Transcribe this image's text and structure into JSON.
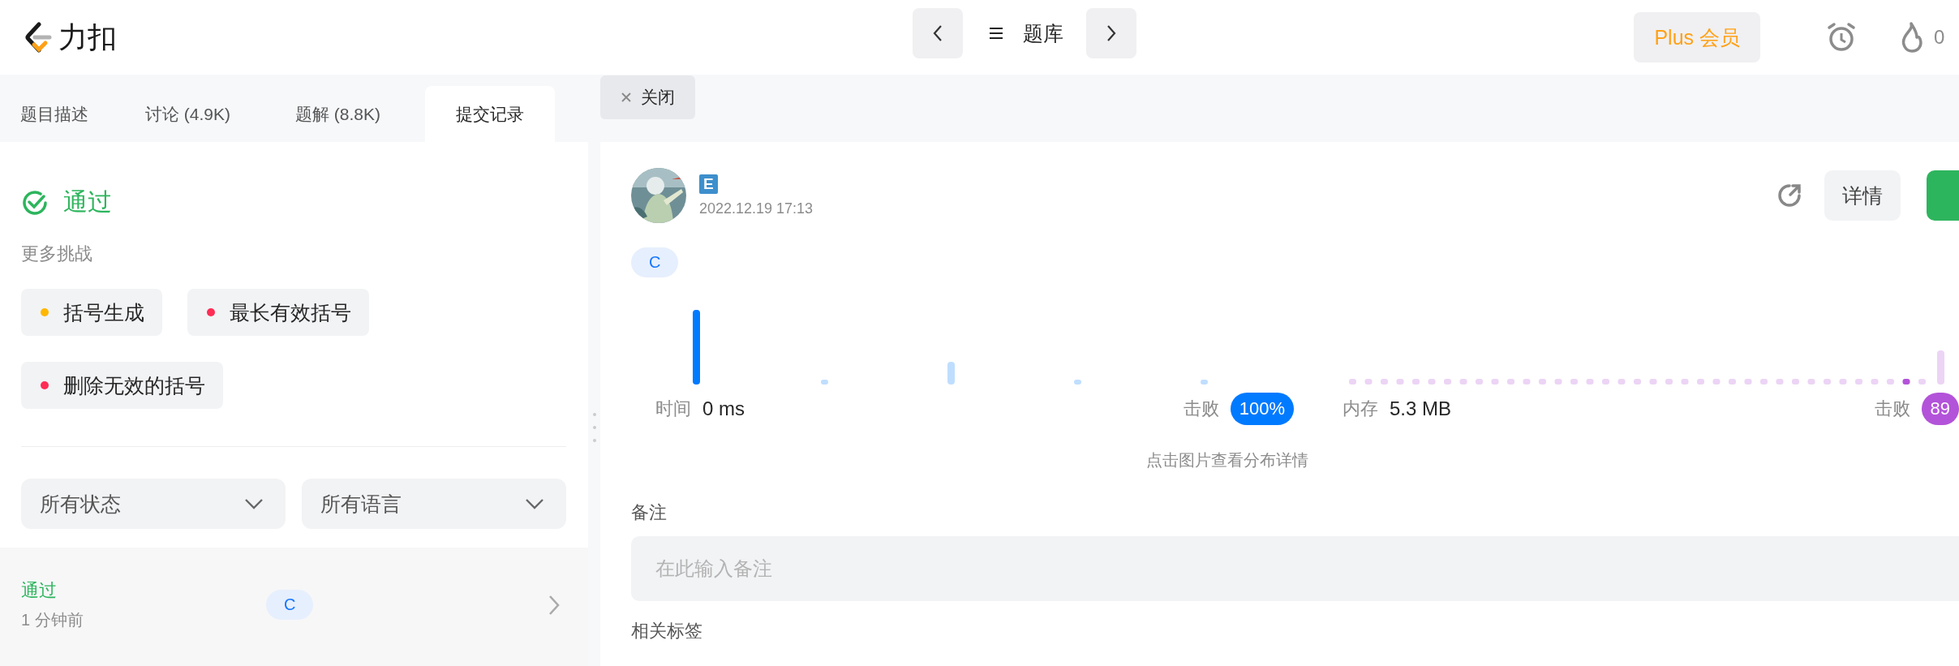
{
  "header": {
    "logo": "力扣",
    "nav_title": "题库",
    "plus_button": "Plus 会员",
    "streak_count": "0"
  },
  "tabs": [
    {
      "label": "题目描述",
      "selected": false
    },
    {
      "label": "讨论 (4.9K)",
      "selected": false
    },
    {
      "label": "题解 (8.8K)",
      "selected": false
    },
    {
      "label": "提交记录",
      "selected": true
    }
  ],
  "close_tab": "关闭",
  "result": {
    "status": "通过",
    "more_label": "更多挑战"
  },
  "challenges": [
    {
      "label": "括号生成",
      "color": "#ffb800"
    },
    {
      "label": "最长有效括号",
      "color": "#ff2d55"
    },
    {
      "label": "删除无效的括号",
      "color": "#ff2d55"
    }
  ],
  "filters": [
    "所有状态",
    "所有语言"
  ],
  "submissions": [
    {
      "status": "通过",
      "time": "1 分钟前",
      "language": "C"
    }
  ],
  "detail": {
    "badge": "E",
    "date": "2022.12.19 17:13",
    "language": "C",
    "detail_button": "详情",
    "hint": "点击图片查看分布详情",
    "note_label": "备注",
    "note_placeholder": "在此输入备注",
    "tags_label": "相关标签"
  },
  "stats": [
    {
      "kind": "time",
      "label": "时间",
      "value": "0 ms",
      "beat_label": "击败",
      "percent": "100%",
      "color": "#007aff"
    },
    {
      "kind": "memory",
      "label": "内存",
      "value": "5.3 MB",
      "beat_label": "击败",
      "percent": "89",
      "color": "#b353d9"
    }
  ]
}
